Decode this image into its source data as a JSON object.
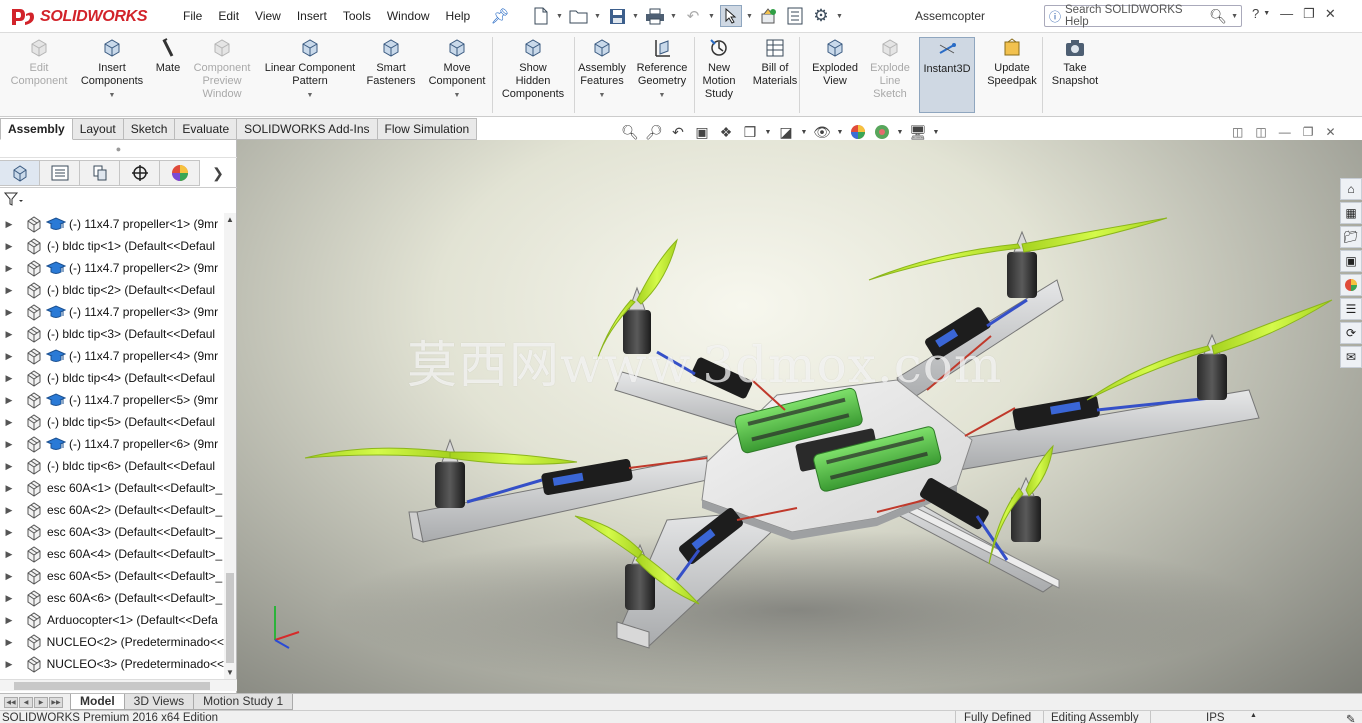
{
  "app": {
    "brand": "SOLIDWORKS",
    "document_title": "Assemcopter",
    "menus": [
      "File",
      "Edit",
      "View",
      "Insert",
      "Tools",
      "Window",
      "Help"
    ],
    "help_search_placeholder": "Search SOLIDWORKS Help"
  },
  "command_manager": [
    {
      "label": "Edit\nComponent",
      "enabled": false,
      "icon": "edit-component-icon"
    },
    {
      "label": "Insert\nComponents",
      "enabled": true,
      "icon": "insert-components-icon",
      "dropdown": true
    },
    {
      "label": "Mate",
      "enabled": true,
      "icon": "mate-icon"
    },
    {
      "label": "Component\nPreview\nWindow",
      "enabled": false,
      "icon": "component-preview-icon"
    },
    {
      "label": "Linear Component\nPattern",
      "enabled": true,
      "icon": "linear-pattern-icon",
      "dropdown": true
    },
    {
      "label": "Smart\nFasteners",
      "enabled": true,
      "icon": "smart-fasteners-icon"
    },
    {
      "label": "Move\nComponent",
      "enabled": true,
      "icon": "move-component-icon",
      "dropdown": true
    },
    {
      "label": "Show\nHidden\nComponents",
      "enabled": true,
      "icon": "show-hidden-icon"
    },
    {
      "label": "Assembly\nFeatures",
      "enabled": true,
      "icon": "assembly-features-icon",
      "dropdown": true
    },
    {
      "label": "Reference\nGeometry",
      "enabled": true,
      "icon": "reference-geometry-icon",
      "dropdown": true
    },
    {
      "label": "New\nMotion\nStudy",
      "enabled": true,
      "icon": "motion-study-icon"
    },
    {
      "label": "Bill of\nMaterials",
      "enabled": true,
      "icon": "bill-of-materials-icon"
    },
    {
      "label": "Exploded\nView",
      "enabled": true,
      "icon": "exploded-view-icon"
    },
    {
      "label": "Explode\nLine\nSketch",
      "enabled": false,
      "icon": "explode-line-sketch-icon"
    },
    {
      "label": "Instant3D",
      "enabled": true,
      "icon": "instant3d-icon",
      "active": true
    },
    {
      "label": "Update\nSpeedpak",
      "enabled": true,
      "icon": "speedpak-icon"
    },
    {
      "label": "Take\nSnapshot",
      "enabled": true,
      "icon": "snapshot-icon"
    }
  ],
  "cm_tabs": [
    "Assembly",
    "Layout",
    "Sketch",
    "Evaluate",
    "SOLIDWORKS Add-Ins",
    "Flow Simulation"
  ],
  "cm_active_tab": "Assembly",
  "tree": [
    {
      "text": "(-) 11x4.7 propeller<1> (9mr",
      "capped": true
    },
    {
      "text": "(-) bldc tip<1> (Default<<Defaul",
      "capped": false
    },
    {
      "text": "(-) 11x4.7 propeller<2> (9mr",
      "capped": true
    },
    {
      "text": "(-) bldc tip<2> (Default<<Defaul",
      "capped": false
    },
    {
      "text": "(-) 11x4.7 propeller<3> (9mr",
      "capped": true
    },
    {
      "text": "(-) bldc tip<3> (Default<<Defaul",
      "capped": false
    },
    {
      "text": "(-) 11x4.7 propeller<4> (9mr",
      "capped": true
    },
    {
      "text": "(-) bldc tip<4> (Default<<Defaul",
      "capped": false
    },
    {
      "text": "(-) 11x4.7 propeller<5> (9mr",
      "capped": true
    },
    {
      "text": "(-) bldc tip<5> (Default<<Defaul",
      "capped": false
    },
    {
      "text": "(-) 11x4.7 propeller<6> (9mr",
      "capped": true
    },
    {
      "text": "(-) bldc tip<6> (Default<<Defaul",
      "capped": false
    },
    {
      "text": "esc 60A<1> (Default<<Default>_",
      "capped": false
    },
    {
      "text": "esc 60A<2> (Default<<Default>_",
      "capped": false
    },
    {
      "text": "esc 60A<3> (Default<<Default>_",
      "capped": false
    },
    {
      "text": "esc 60A<4> (Default<<Default>_",
      "capped": false
    },
    {
      "text": "esc 60A<5> (Default<<Default>_",
      "capped": false
    },
    {
      "text": "esc 60A<6> (Default<<Default>_",
      "capped": false
    },
    {
      "text": "Arduocopter<1> (Default<<Defa",
      "capped": false
    },
    {
      "text": "NUCLEO<2> (Predeterminado<<",
      "capped": false
    },
    {
      "text": "NUCLEO<3> (Predeterminado<<",
      "capped": false
    }
  ],
  "watermark": "莫西网www.3dmox.com",
  "bottom_tabs": [
    "Model",
    "3D Views",
    "Motion Study 1"
  ],
  "bottom_active": "Model",
  "status": {
    "edition": "SOLIDWORKS Premium 2016 x64 Edition",
    "defined": "Fully Defined",
    "mode": "Editing Assembly",
    "units": "IPS"
  },
  "colors": {
    "brand_red": "#d2232a",
    "propeller": "#c9f23a",
    "battery": "#59c84a",
    "arm": "#cfd1d3"
  }
}
